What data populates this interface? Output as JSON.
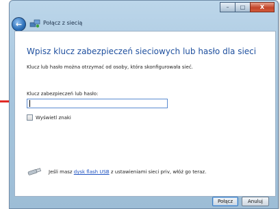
{
  "window": {
    "title": "Połącz z siecią",
    "caption_minimize": "–",
    "caption_maximize": "□",
    "caption_close": "X"
  },
  "dialog": {
    "heading": "Wpisz klucz zabezpieczeń sieciowych lub hasło dla sieci",
    "subtext": "Klucz lub hasło można otrzymać od osoby, która skonfigurowała sieć.",
    "key_label": "Klucz zabezpieczeń lub hasło:",
    "key_value": "",
    "show_chars_label": "Wyświetl znaki",
    "usb_text_before": "Jeśli masz ",
    "usb_link": "dysk flash USB",
    "usb_text_after": " z ustawieniami sieci priv, włóż go teraz."
  },
  "buttons": {
    "connect": "Połącz",
    "cancel": "Anuluj"
  },
  "colors": {
    "heading": "#1e4f9e",
    "arrow": "#e0211b"
  }
}
